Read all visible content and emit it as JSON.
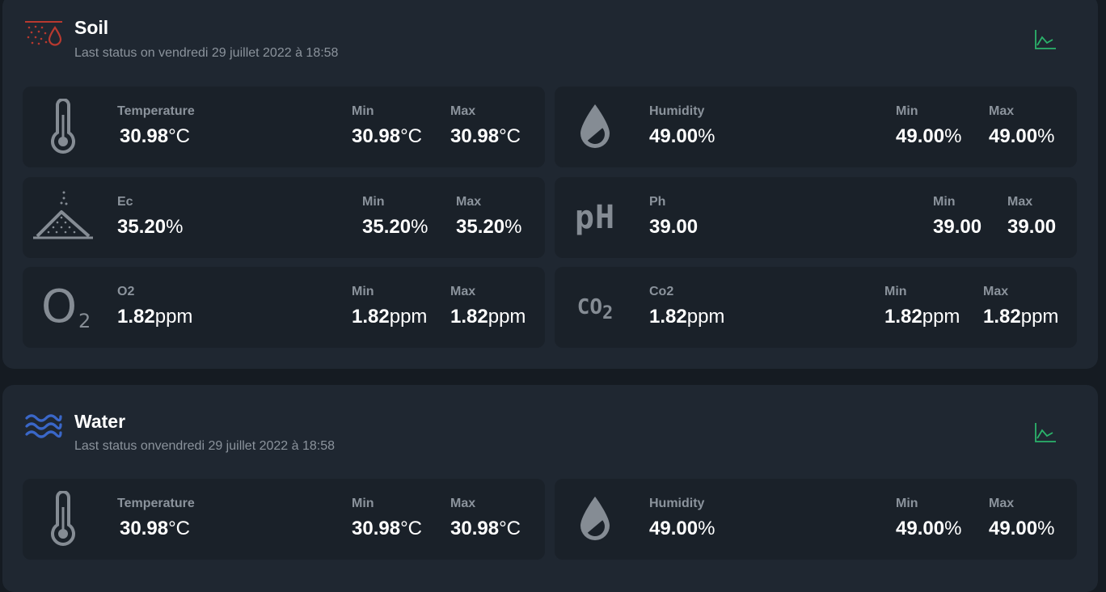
{
  "colors": {
    "accent_green": "#2bb36b",
    "soil_icon": "#b8392f",
    "water_icon": "#3a67c8"
  },
  "soil": {
    "title": "Soil",
    "subtitle": "Last status on vendredi 29 juillet 2022 à 18:58",
    "icon": "soil-icon",
    "metrics": [
      {
        "icon": "thermometer-icon",
        "label": "Temperature",
        "value": "30.98",
        "unit": "°C",
        "min_label": "Min",
        "min": "30.98",
        "min_unit": "°C",
        "max_label": "Max",
        "max": "30.98",
        "max_unit": "°C"
      },
      {
        "icon": "droplet-icon",
        "label": "Humidity",
        "value": "49.00",
        "unit": "%",
        "min_label": "Min",
        "min": "49.00",
        "min_unit": "%",
        "max_label": "Max",
        "max": "49.00",
        "max_unit": "%"
      },
      {
        "icon": "fertilizer-pile-icon",
        "label": "Ec",
        "value": "35.20",
        "unit": "%",
        "min_label": "Min",
        "min": "35.20",
        "min_unit": "%",
        "max_label": "Max",
        "max": "35.20",
        "max_unit": "%"
      },
      {
        "icon": "ph-icon",
        "icon_text": "pH",
        "label": "Ph",
        "value": "39.00",
        "unit": "",
        "min_label": "Min",
        "min": "39.00",
        "min_unit": "",
        "max_label": "Max",
        "max": "39.00",
        "max_unit": ""
      },
      {
        "icon": "o2-icon",
        "icon_text_main": "O",
        "icon_text_sub": "2",
        "label": "O2",
        "value": "1.82",
        "unit": "ppm",
        "min_label": "Min",
        "min": "1.82",
        "min_unit": "ppm",
        "max_label": "Max",
        "max": "1.82",
        "max_unit": "ppm"
      },
      {
        "icon": "co2-icon",
        "icon_text_main": "CO",
        "icon_text_sub": "2",
        "label": "Co2",
        "value": "1.82",
        "unit": "ppm",
        "min_label": "Min",
        "min": "1.82",
        "min_unit": "ppm",
        "max_label": "Max",
        "max": "1.82",
        "max_unit": "ppm"
      }
    ]
  },
  "water": {
    "title": "Water",
    "subtitle": "Last status onvendredi 29 juillet 2022 à 18:58",
    "icon": "water-waves-icon",
    "metrics": [
      {
        "icon": "thermometer-icon",
        "label": "Temperature",
        "value": "30.98",
        "unit": "°C",
        "min_label": "Min",
        "min": "30.98",
        "min_unit": "°C",
        "max_label": "Max",
        "max": "30.98",
        "max_unit": "°C"
      },
      {
        "icon": "droplet-icon",
        "label": "Humidity",
        "value": "49.00",
        "unit": "%",
        "min_label": "Min",
        "min": "49.00",
        "min_unit": "%",
        "max_label": "Max",
        "max": "49.00",
        "max_unit": "%"
      }
    ]
  }
}
